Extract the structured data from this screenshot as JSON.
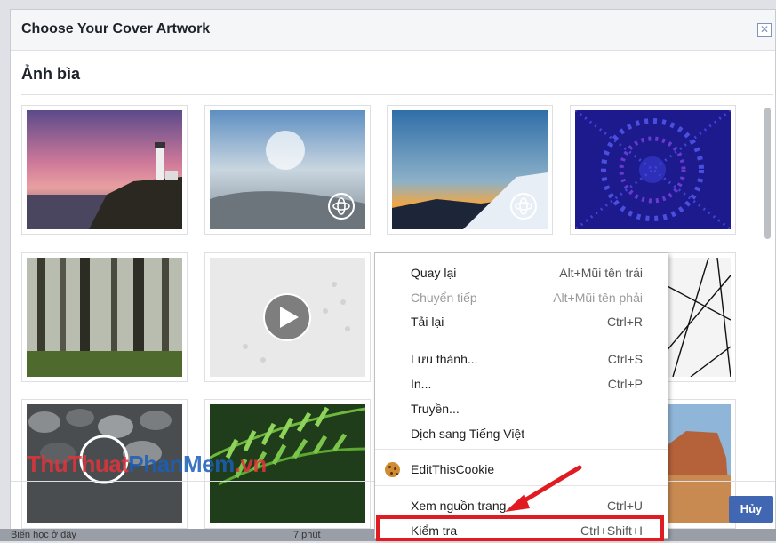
{
  "dialog": {
    "title": "Choose Your Cover Artwork",
    "close_icon": "close-icon",
    "section_title": "Ảnh bìa",
    "cancel_label": "Hủy"
  },
  "tiles": [
    {
      "name": "lighthouse-sunset"
    },
    {
      "name": "sky-clouds-360",
      "badge": "360-icon"
    },
    {
      "name": "mountain-sunrise-360",
      "badge": "360-icon"
    },
    {
      "name": "blue-kaleidoscope"
    },
    {
      "name": "misty-forest"
    },
    {
      "name": "white-dots-video",
      "badge": "play-icon"
    },
    {
      "name": "hidden-tile"
    },
    {
      "name": "black-lines"
    },
    {
      "name": "stones-video",
      "badge": "play-icon"
    },
    {
      "name": "fern-leaves"
    },
    {
      "name": "hidden-tile-2"
    },
    {
      "name": "desert-rocks"
    }
  ],
  "context_menu": {
    "items": [
      {
        "label": "Quay lại",
        "shortcut": "Alt+Mũi tên trái",
        "disabled": false
      },
      {
        "label": "Chuyển tiếp",
        "shortcut": "Alt+Mũi tên phải",
        "disabled": true
      },
      {
        "label": "Tải lại",
        "shortcut": "Ctrl+R",
        "disabled": false
      },
      {
        "label": "Lưu thành...",
        "shortcut": "Ctrl+S",
        "disabled": false
      },
      {
        "label": "In...",
        "shortcut": "Ctrl+P",
        "disabled": false
      },
      {
        "label": "Truyền...",
        "shortcut": "",
        "disabled": false
      },
      {
        "label": "Dịch sang Tiếng Việt",
        "shortcut": "",
        "disabled": false
      },
      {
        "label": "EditThisCookie",
        "shortcut": "",
        "disabled": false,
        "icon": "cookie-icon"
      },
      {
        "label": "Xem nguồn trang",
        "shortcut": "Ctrl+U",
        "disabled": false
      },
      {
        "label": "Kiểm tra",
        "shortcut": "Ctrl+Shift+I",
        "disabled": false,
        "highlighted": true
      }
    ]
  },
  "watermark": {
    "part1": "ThuThuat",
    "part2": "PhanMem",
    "part3": ".vn"
  },
  "background": {
    "left_text": "Biến học ở đây",
    "right_text": "7 phút"
  },
  "colors": {
    "accent": "#4267b2",
    "highlight": "#e01b22"
  }
}
